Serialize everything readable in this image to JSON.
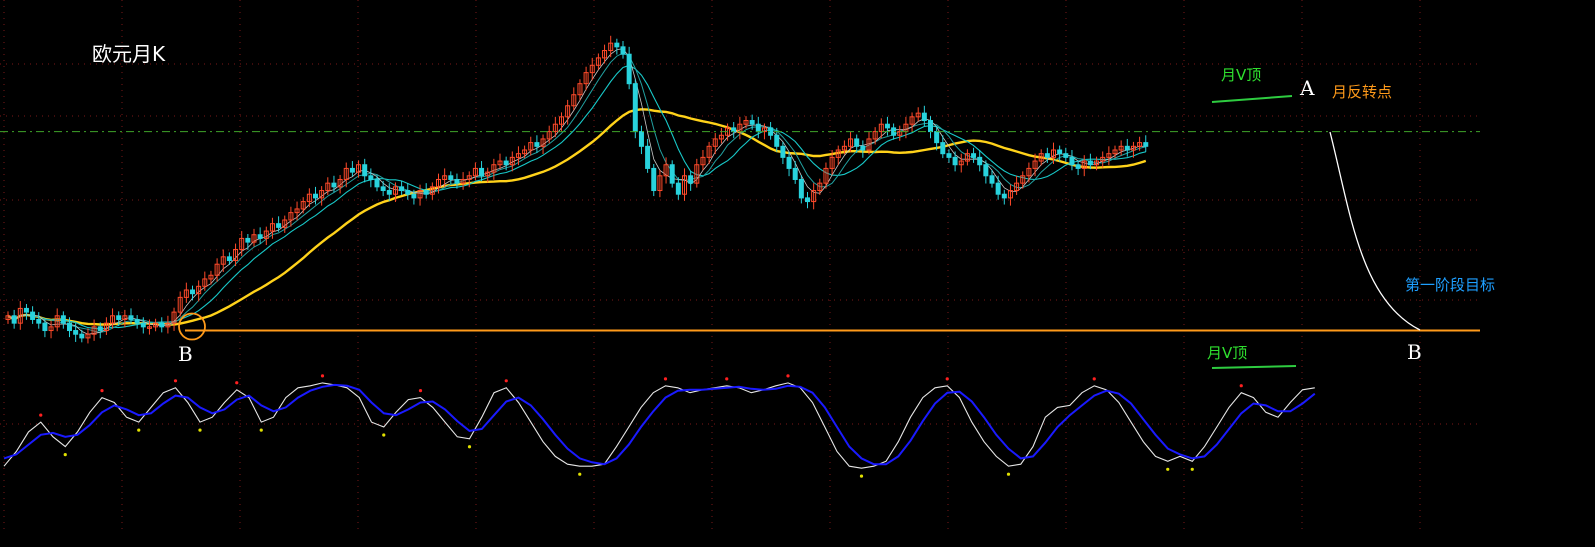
{
  "chart_data": {
    "type": "candlestick",
    "title": "欧元月K",
    "grid": true,
    "annotations": {
      "v_top_upper": "月V顶",
      "reversal_point": "月反转点",
      "stage_target": "第一阶段目标",
      "v_top_lower": "月V顶",
      "point_a": "A",
      "point_b_left": "B",
      "point_b_right": "B"
    },
    "colors": {
      "up_candle": "#ff4a2a",
      "down_candle": "#29d3dd",
      "ma_long": "#ffd21a",
      "ma_mid": "#18c8c8",
      "ma_short": "#c8c8c8",
      "support_line": "#ff9a1a",
      "resistance_line": "#2ecc40",
      "projection_line": "#ffffff",
      "osc_fast": "#e6e6e6",
      "osc_slow": "#1a1aff",
      "osc_top_marker": "#ff2020",
      "osc_bottom_marker": "#e0e000"
    },
    "closes": [
      1.12,
      1.1,
      1.14,
      1.13,
      1.11,
      1.1,
      1.08,
      1.09,
      1.12,
      1.1,
      1.08,
      1.07,
      1.06,
      1.07,
      1.09,
      1.08,
      1.1,
      1.12,
      1.11,
      1.12,
      1.11,
      1.1,
      1.09,
      1.09,
      1.1,
      1.09,
      1.1,
      1.13,
      1.17,
      1.19,
      1.18,
      1.2,
      1.22,
      1.23,
      1.26,
      1.28,
      1.27,
      1.3,
      1.33,
      1.32,
      1.34,
      1.33,
      1.35,
      1.37,
      1.36,
      1.38,
      1.4,
      1.41,
      1.43,
      1.45,
      1.44,
      1.46,
      1.48,
      1.47,
      1.49,
      1.52,
      1.51,
      1.53,
      1.5,
      1.49,
      1.47,
      1.46,
      1.45,
      1.47,
      1.46,
      1.45,
      1.44,
      1.46,
      1.45,
      1.47,
      1.49,
      1.5,
      1.49,
      1.48,
      1.49,
      1.5,
      1.52,
      1.5,
      1.51,
      1.53,
      1.54,
      1.53,
      1.55,
      1.56,
      1.57,
      1.59,
      1.58,
      1.6,
      1.62,
      1.64,
      1.66,
      1.69,
      1.72,
      1.75,
      1.78,
      1.8,
      1.82,
      1.84,
      1.86,
      1.85,
      1.83,
      1.75,
      1.62,
      1.58,
      1.52,
      1.46,
      1.5,
      1.53,
      1.48,
      1.45,
      1.5,
      1.48,
      1.53,
      1.55,
      1.58,
      1.6,
      1.61,
      1.63,
      1.62,
      1.64,
      1.65,
      1.64,
      1.62,
      1.63,
      1.61,
      1.58,
      1.55,
      1.52,
      1.49,
      1.44,
      1.43,
      1.46,
      1.48,
      1.52,
      1.55,
      1.57,
      1.58,
      1.6,
      1.58,
      1.57,
      1.6,
      1.62,
      1.64,
      1.63,
      1.61,
      1.62,
      1.64,
      1.66,
      1.67,
      1.65,
      1.62,
      1.59,
      1.56,
      1.55,
      1.53,
      1.54,
      1.56,
      1.55,
      1.53,
      1.5,
      1.48,
      1.45,
      1.44,
      1.46,
      1.48,
      1.5,
      1.52,
      1.54,
      1.56,
      1.55,
      1.57,
      1.56,
      1.55,
      1.53,
      1.52,
      1.54,
      1.53,
      1.54,
      1.55,
      1.56,
      1.57,
      1.58,
      1.57,
      1.58,
      1.59,
      1.58
    ],
    "ohlc_scale": {
      "ylim": [
        1.0,
        1.95
      ]
    },
    "support_level": 1.08,
    "resistance_level": 1.62,
    "oscillator": {
      "series": [
        {
          "values": [
            10,
            25,
            45,
            55,
            40,
            30,
            45,
            65,
            80,
            75,
            60,
            55,
            70,
            85,
            90,
            75,
            55,
            60,
            75,
            88,
            80,
            55,
            60,
            80,
            90,
            92,
            95,
            93,
            90,
            80,
            55,
            50,
            65,
            78,
            80,
            70,
            55,
            40,
            38,
            60,
            85,
            90,
            75,
            55,
            35,
            20,
            12,
            10,
            10,
            12,
            30,
            50,
            70,
            85,
            92,
            90,
            85,
            88,
            90,
            92,
            90,
            85,
            88,
            92,
            95,
            90,
            75,
            50,
            25,
            10,
            8,
            10,
            15,
            35,
            60,
            80,
            90,
            92,
            80,
            55,
            35,
            20,
            10,
            12,
            30,
            60,
            70,
            72,
            85,
            92,
            88,
            75,
            55,
            35,
            20,
            15,
            20,
            15,
            30,
            50,
            70,
            85,
            80,
            65,
            60,
            75,
            88,
            90
          ]
        },
        {
          "values": [
            18,
            22,
            32,
            42,
            44,
            40,
            42,
            52,
            65,
            72,
            68,
            62,
            64,
            74,
            82,
            80,
            70,
            64,
            68,
            78,
            82,
            72,
            66,
            70,
            80,
            87,
            91,
            93,
            92,
            88,
            75,
            64,
            62,
            68,
            75,
            76,
            68,
            56,
            46,
            48,
            62,
            76,
            80,
            72,
            58,
            42,
            28,
            18,
            14,
            12,
            18,
            32,
            50,
            66,
            80,
            87,
            88,
            88,
            89,
            90,
            91,
            89,
            88,
            89,
            92,
            91,
            85,
            70,
            50,
            30,
            18,
            12,
            12,
            20,
            36,
            56,
            74,
            85,
            86,
            76,
            60,
            42,
            28,
            18,
            20,
            34,
            50,
            62,
            72,
            82,
            87,
            84,
            74,
            58,
            42,
            28,
            22,
            18,
            20,
            32,
            48,
            64,
            74,
            72,
            66,
            66,
            74,
            84
          ]
        }
      ],
      "ylim": [
        0,
        100
      ]
    }
  }
}
